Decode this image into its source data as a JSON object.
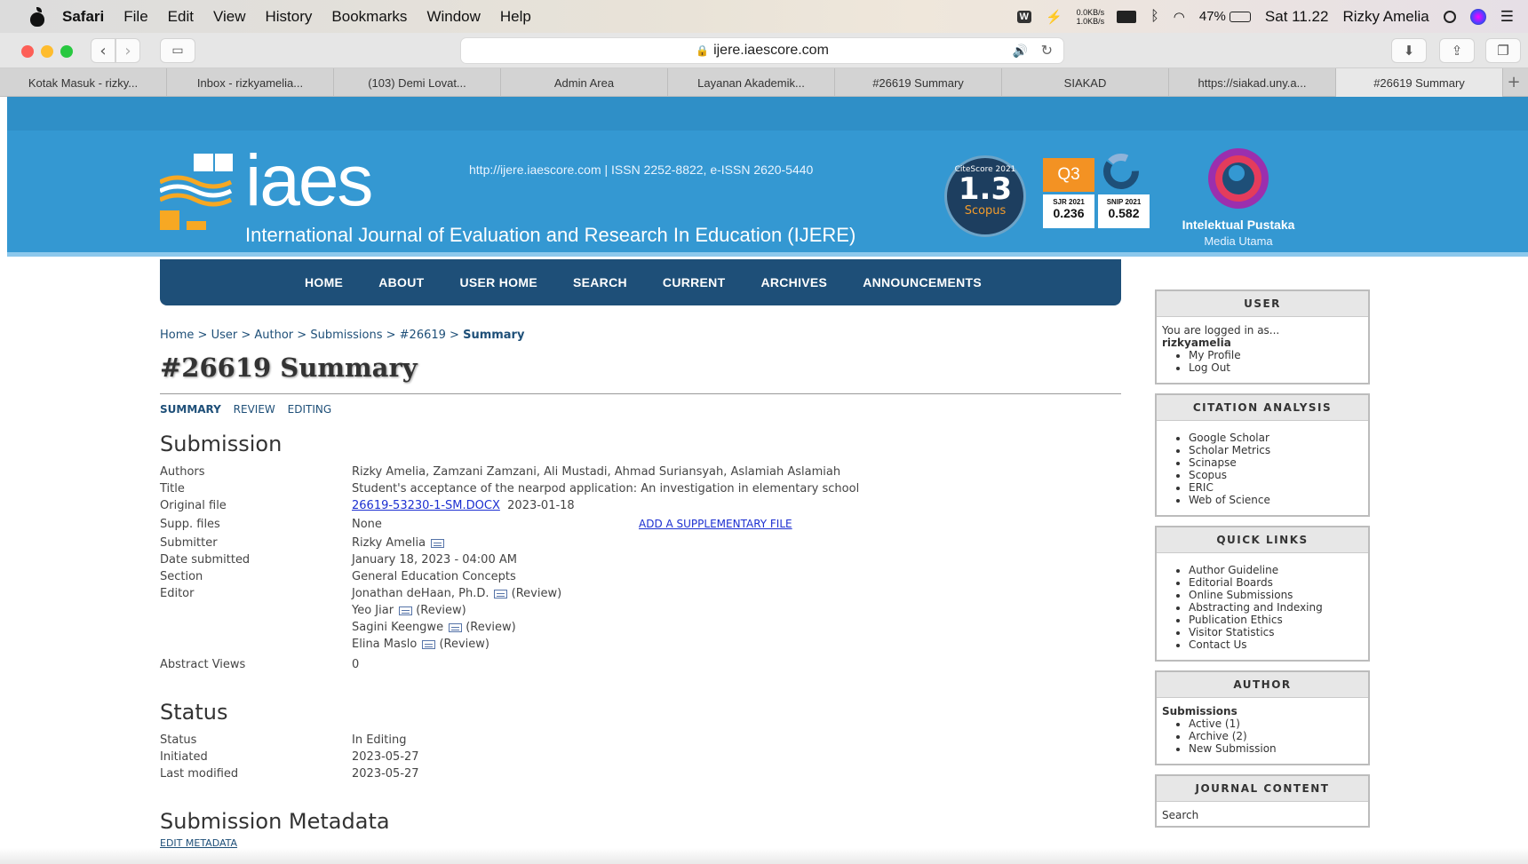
{
  "menubar": {
    "app": "Safari",
    "items": [
      "File",
      "Edit",
      "View",
      "History",
      "Bookmarks",
      "Window",
      "Help"
    ],
    "net_up": "0.0KB/s",
    "net_down": "1.0KB/s",
    "battery": "47%",
    "clock": "Sat 11.22",
    "user": "Rizky Amelia"
  },
  "toolbar": {
    "url": "ijere.iaescore.com"
  },
  "tabs": [
    "Kotak Masuk - rizky...",
    "Inbox - rizkyamelia...",
    "(103) Demi Lovat...",
    "Admin Area",
    "Layanan Akademik...",
    "#26619 Summary",
    "SIAKAD",
    "https://siakad.uny.a...",
    "#26619 Summary"
  ],
  "header": {
    "logo": "iaes",
    "journal_name": "International Journal of Evaluation and Research In Education (IJERE)",
    "issn": "http://ijere.iaescore.com  |  ISSN 2252-8822, e-ISSN 2620-5440",
    "citescore_label": "CiteScore 2021",
    "citescore_value": "1.3",
    "citescore_source": "Scopus",
    "quartile": "Q3",
    "sjr_label": "SJR 2021",
    "sjr_value": "0.236",
    "snip_label": "SNIP 2021",
    "snip_value": "0.582",
    "publisher_name": "Intelektual Pustaka",
    "publisher_sub": "Media Utama"
  },
  "nav": [
    "HOME",
    "ABOUT",
    "USER HOME",
    "SEARCH",
    "CURRENT",
    "ARCHIVES",
    "ANNOUNCEMENTS"
  ],
  "breadcrumb": {
    "items": [
      "Home",
      "User",
      "Author",
      "Submissions",
      "#26619"
    ],
    "current": "Summary"
  },
  "page_title": "#26619 Summary",
  "subtabs": [
    "SUMMARY",
    "REVIEW",
    "EDITING"
  ],
  "submission": {
    "heading": "Submission",
    "authors_label": "Authors",
    "authors": "Rizky Amelia, Zamzani Zamzani, Ali Mustadi, Ahmad Suriansyah, Aslamiah Aslamiah",
    "title_label": "Title",
    "title": "Student's acceptance of the nearpod application: An investigation in elementary school",
    "original_file_label": "Original file",
    "original_file": "26619-53230-1-SM.DOCX",
    "original_file_date": "2023-01-18",
    "supp_label": "Supp. files",
    "supp_value": "None",
    "supp_add": "ADD A SUPPLEMENTARY FILE",
    "submitter_label": "Submitter",
    "submitter": "Rizky Amelia",
    "date_label": "Date submitted",
    "date": "January 18, 2023 - 04:00 AM",
    "section_label": "Section",
    "section": "General Education Concepts",
    "editor_label": "Editor",
    "editors": [
      {
        "name": "Jonathan deHaan, Ph.D.",
        "role": "(Review)"
      },
      {
        "name": "Yeo Jiar",
        "role": "(Review)"
      },
      {
        "name": "Sagini Keengwe",
        "role": "(Review)"
      },
      {
        "name": "Elina Maslo",
        "role": "(Review)"
      }
    ],
    "abstract_label": "Abstract Views",
    "abstract_views": "0"
  },
  "status": {
    "heading": "Status",
    "status_label": "Status",
    "status": "In Editing",
    "initiated_label": "Initiated",
    "initiated": "2023-05-27",
    "modified_label": "Last modified",
    "modified": "2023-05-27"
  },
  "metadata": {
    "heading": "Submission Metadata",
    "edit": "EDIT METADATA"
  },
  "sidebar": {
    "user": {
      "title": "USER",
      "logged_in": "You are logged in as...",
      "username": "rizkyamelia",
      "links": [
        "My Profile",
        "Log Out"
      ]
    },
    "citation": {
      "title": "CITATION ANALYSIS",
      "links": [
        "Google Scholar",
        "Scholar Metrics",
        "Scinapse",
        "Scopus",
        "ERIC",
        "Web of Science"
      ]
    },
    "quick": {
      "title": "QUICK LINKS",
      "links": [
        "Author Guideline",
        "Editorial Boards",
        "Online Submissions",
        "Abstracting and Indexing",
        "Publication Ethics",
        "Visitor Statistics",
        "Contact Us"
      ]
    },
    "author": {
      "title": "AUTHOR",
      "heading": "Submissions",
      "links": [
        "Active (1)",
        "Archive (2)",
        "New Submission"
      ]
    },
    "journal": {
      "title": "JOURNAL CONTENT",
      "search": "Search"
    }
  }
}
